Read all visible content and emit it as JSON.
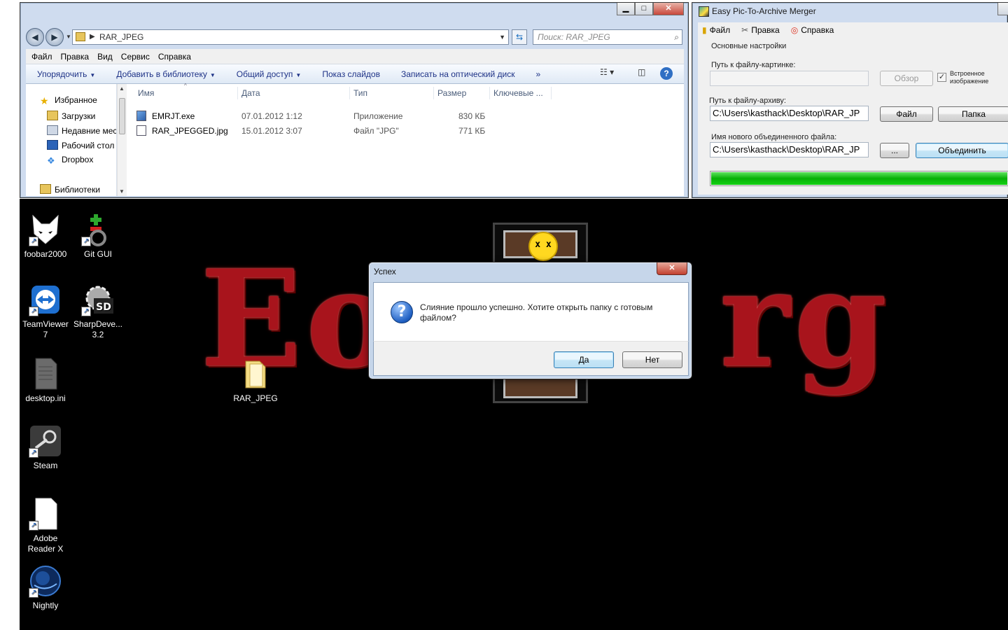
{
  "explorer": {
    "address": "RAR_JPEG",
    "search_placeholder": "Поиск: RAR_JPEG",
    "menu": [
      "Файл",
      "Правка",
      "Вид",
      "Сервис",
      "Справка"
    ],
    "toolbar": {
      "organize": "Упорядочить",
      "add_library": "Добавить в библиотеку",
      "share": "Общий доступ",
      "slideshow": "Показ слайдов",
      "burn": "Записать на оптический диск",
      "more": "»"
    },
    "nav": {
      "favorites": "Избранное",
      "downloads": "Загрузки",
      "recent": "Недавние мес",
      "desktop": "Рабочий стол",
      "dropbox": "Dropbox",
      "libraries": "Библиотеки"
    },
    "columns": {
      "name": "Имя",
      "date": "Дата",
      "type": "Тип",
      "size": "Размер",
      "tags": "Ключевые ..."
    },
    "files": [
      {
        "name": "EMRJT.exe",
        "date": "07.01.2012 1:12",
        "type": "Приложение",
        "size": "830 КБ"
      },
      {
        "name": "RAR_JPEGGED.jpg",
        "date": "15.01.2012 3:07",
        "type": "Файл \"JPG\"",
        "size": "771 КБ"
      }
    ]
  },
  "merger": {
    "title": "Easy Pic-To-Archive Merger",
    "menu": {
      "file": "Файл",
      "edit": "Правка",
      "help": "Справка"
    },
    "group_title": "Основные настройки",
    "image_path_label": "Путь к файлу-картинке:",
    "image_path_value": "",
    "browse_button": "Обзор",
    "embedded_label": "Встроенное изображение",
    "embedded_checked": true,
    "archive_path_label": "Путь к файлу-архиву:",
    "archive_path_value": "C:\\Users\\kasthack\\Desktop\\RAR_JP",
    "file_button": "Файл",
    "folder_button": "Папка",
    "output_label": "Имя нового объединенного файла:",
    "output_value": "C:\\Users\\kasthack\\Desktop\\RAR_JP",
    "dots_button": "...",
    "merge_button": "Объединить",
    "progress_percent": 100
  },
  "dialog": {
    "title": "Успех",
    "message": "Слияние прошло успешно. Хотите открыть папку с готовым файлом?",
    "yes": "Да",
    "no": "Нет"
  },
  "desktop": {
    "icons": [
      {
        "label": "foobar2000"
      },
      {
        "label": "Git GUI"
      },
      {
        "label": "TeamViewer 7"
      },
      {
        "label": "SharpDeve... 3.2"
      },
      {
        "label": "desktop.ini"
      },
      {
        "label": "RAR_JPEG"
      },
      {
        "label": "Steam"
      },
      {
        "label": "Adobe Reader X"
      },
      {
        "label": "Nightly"
      }
    ]
  },
  "colors": {
    "progress_green": "#06b006",
    "desktop_bg": "#000000",
    "wallpaper_red": "#a8141c"
  }
}
